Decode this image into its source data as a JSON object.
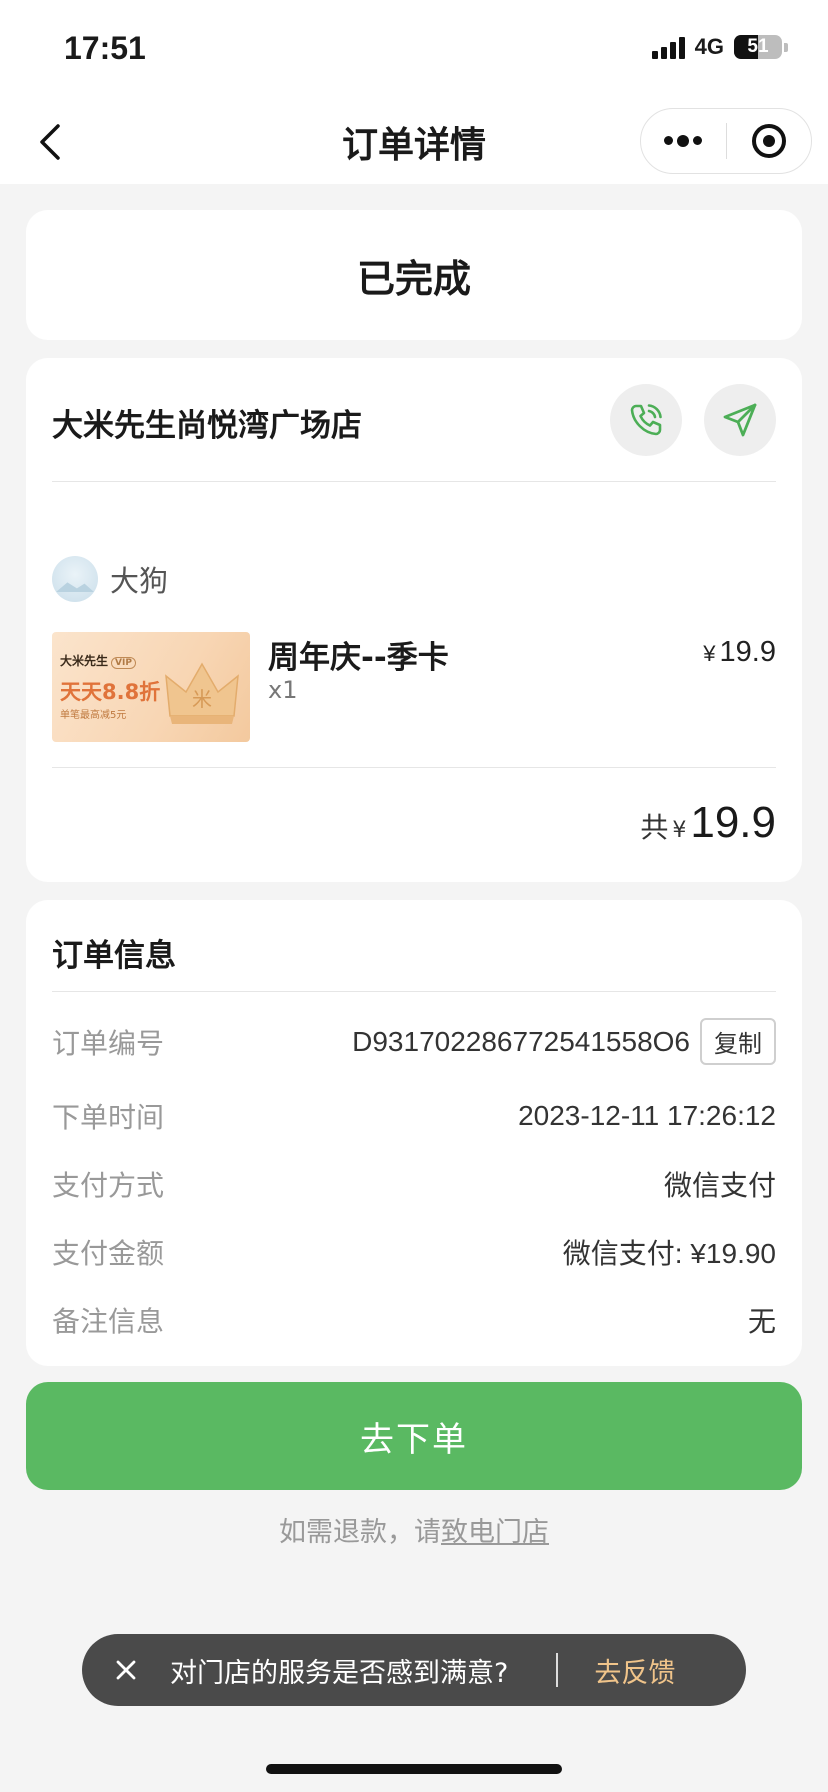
{
  "status_bar": {
    "time": "17:51",
    "network": "4G",
    "battery": "51",
    "battery_level": 0.51
  },
  "nav": {
    "title": "订单详情",
    "back_icon": "chevron-left-icon",
    "more_icon": "more-dots-icon",
    "close_icon": "target-icon"
  },
  "order_status": {
    "text": "已完成"
  },
  "store": {
    "name": "大米先生尚悦湾广场店",
    "user_name": "大狗",
    "product": {
      "image_brand": "大米先生",
      "image_vip": "VIP",
      "image_main": "天天8.8折",
      "image_sub": "单笔最高减5元",
      "image_crown_char": "米",
      "name": "周年庆--季卡",
      "qty": "x1",
      "currency": "¥",
      "price": "19.9"
    },
    "total": {
      "label": "共",
      "currency": "¥",
      "amount": "19.9"
    }
  },
  "order_info": {
    "title": "订单信息",
    "rows": [
      {
        "label": "订单编号",
        "value": "D931702286772541558O6"
      },
      {
        "label": "下单时间",
        "value": "2023-12-11 17:26:12"
      },
      {
        "label": "支付方式",
        "value": "微信支付"
      },
      {
        "label": "支付金额",
        "value": "微信支付: ¥19.90"
      },
      {
        "label": "备注信息",
        "value": "无"
      }
    ],
    "copy_label": "复制"
  },
  "actions": {
    "order_button": "去下单",
    "refund_prefix": "如需退款，请",
    "refund_link": "致电门店"
  },
  "toast": {
    "text": "对门店的服务是否感到满意?",
    "link": "去反馈"
  },
  "colors": {
    "primary_green": "#5ab962",
    "icon_green": "#4cae56",
    "toast_link": "#f0c48a"
  }
}
